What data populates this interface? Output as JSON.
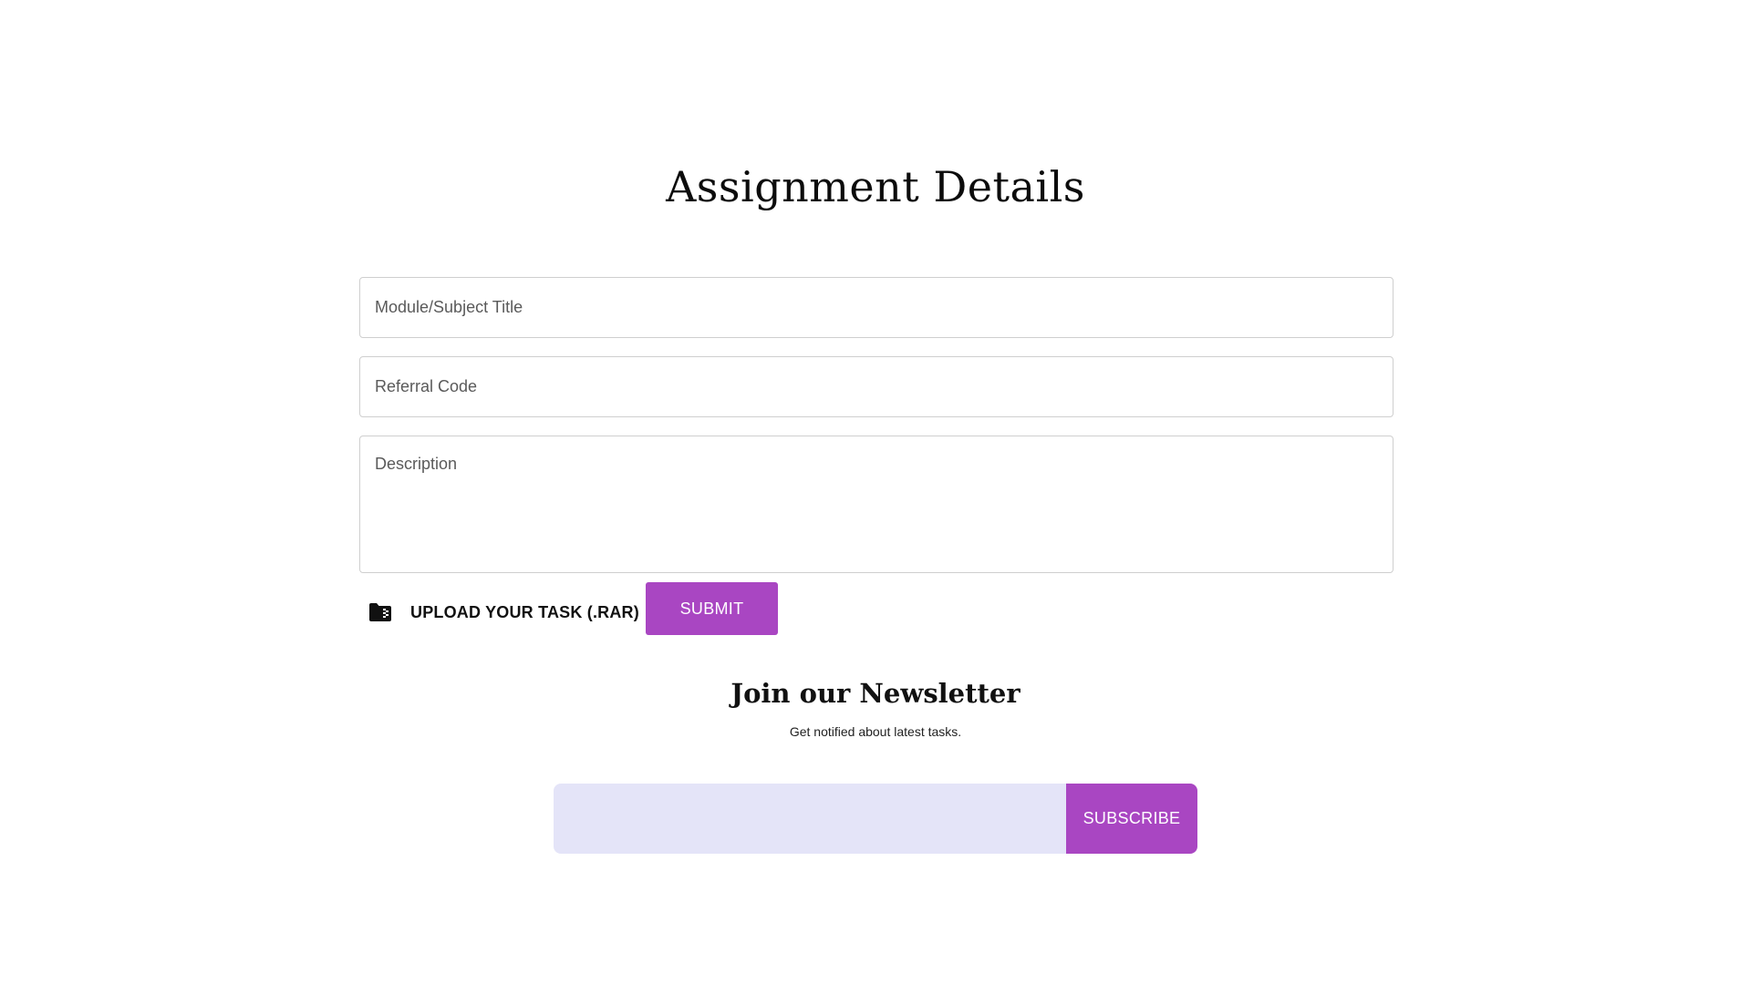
{
  "form": {
    "title": "Assignment Details",
    "fields": {
      "module_title": {
        "placeholder": "Module/Subject Title",
        "value": ""
      },
      "referral_code": {
        "placeholder": "Referral Code",
        "value": ""
      },
      "description": {
        "placeholder": "Description",
        "value": ""
      }
    },
    "upload": {
      "icon": "folder-zip-icon",
      "label": "UPLOAD YOUR TASK (.RAR)"
    },
    "submit_label": "SUBMIT"
  },
  "newsletter": {
    "title": "Join our Newsletter",
    "subtitle": "Get notified about latest tasks.",
    "email_value": "",
    "subscribe_label": "SUBSCRIBE"
  },
  "colors": {
    "accent": "#a946c2",
    "input_background": "#e4e4f8",
    "field_border": "#cfcfcf",
    "text": "#111111"
  }
}
